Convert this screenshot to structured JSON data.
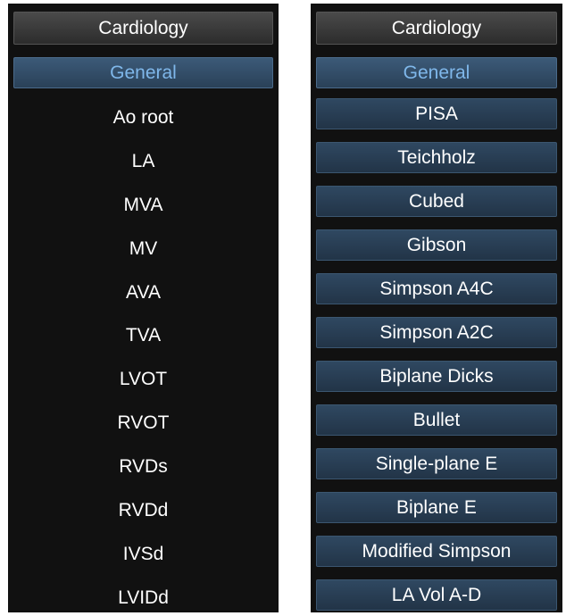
{
  "left_panel": {
    "header": "Cardiology",
    "active_tab": "General",
    "items": [
      "Ao root",
      "LA",
      "MVA",
      "MV",
      "AVA",
      "TVA",
      "LVOT",
      "RVOT",
      "RVDs",
      "RVDd",
      "IVSd",
      "LVIDd"
    ]
  },
  "right_panel": {
    "header": "Cardiology",
    "active_tab": "General",
    "items": [
      "PISA",
      "Teichholz",
      "Cubed",
      "Gibson",
      "Simpson A4C",
      "Simpson A2C",
      "Biplane Dicks",
      "Bullet",
      "Single-plane E",
      "Biplane E",
      "Modified Simpson",
      "LA Vol A-D"
    ]
  }
}
